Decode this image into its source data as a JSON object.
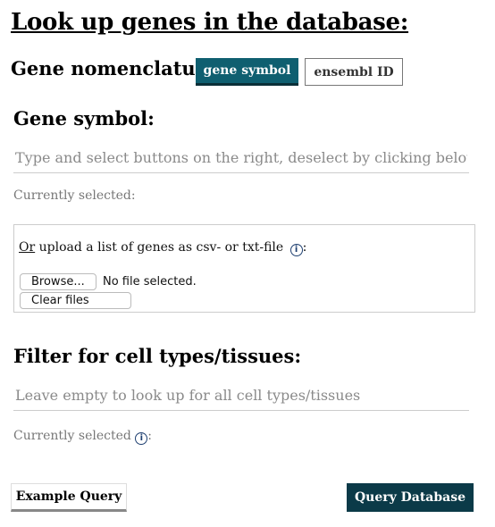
{
  "page": {
    "title": "Look up genes in the database:"
  },
  "nomenclature": {
    "label": "Gene nomenclature:",
    "options": [
      "gene symbol",
      "ensembl ID"
    ],
    "selected": "gene symbol"
  },
  "genes": {
    "heading": "Gene symbol:",
    "input_placeholder": "Type and select buttons on the right, deselect by clicking below",
    "input_value": "",
    "currently_selected_label": "Currently selected:"
  },
  "upload": {
    "or_text": "Or",
    "text": " upload a list of genes as csv- or txt-file ",
    "info_icon": "info-icon",
    "colon": ":",
    "browse_label": "Browse...",
    "file_status": "No file selected.",
    "clear_label": "Clear files"
  },
  "celltypes": {
    "heading": "Filter for cell types/tissues:",
    "input_placeholder": "Leave empty to look up for all cell types/tissues",
    "input_value": "",
    "currently_selected_label": "Currently selected ",
    "info_icon": "info-icon",
    "colon": ":"
  },
  "actions": {
    "example_label": "Example Query",
    "query_label": "Query Database"
  },
  "colors": {
    "active_toggle": "#0f5f70",
    "query_button": "#0b3a48"
  }
}
